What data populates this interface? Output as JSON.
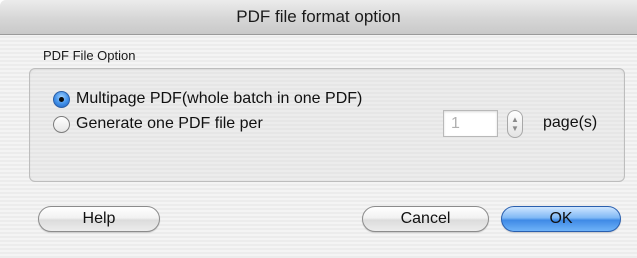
{
  "window": {
    "title": "PDF file format option"
  },
  "group": {
    "label": "PDF File Option",
    "option_multipage": "Multipage PDF(whole batch in one PDF)",
    "option_per_page": "Generate one PDF file per",
    "selected": "multipage",
    "pages_value": "1",
    "pages_suffix": "page(s)"
  },
  "buttons": {
    "help": "Help",
    "cancel": "Cancel",
    "ok": "OK"
  },
  "icons": {
    "stepper_up": "▲",
    "stepper_down": "▼"
  }
}
